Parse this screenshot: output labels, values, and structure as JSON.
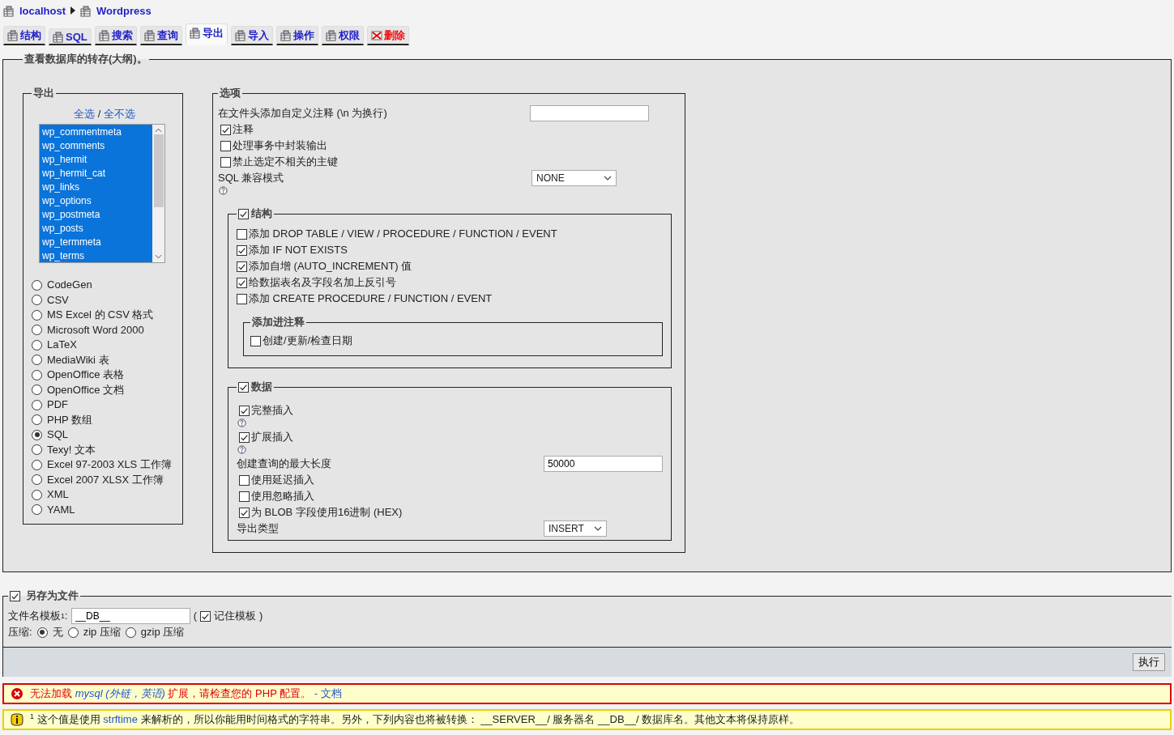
{
  "breadcrumb": [
    {
      "label": "localhost"
    },
    {
      "label": "Wordpress"
    }
  ],
  "tabs": [
    {
      "label": "结构",
      "selected": false,
      "kind": "normal"
    },
    {
      "label": "SQL",
      "selected": false,
      "kind": "normal"
    },
    {
      "label": "搜索",
      "selected": false,
      "kind": "normal"
    },
    {
      "label": "查询",
      "selected": false,
      "kind": "normal"
    },
    {
      "label": "导出",
      "selected": true,
      "kind": "normal"
    },
    {
      "label": "导入",
      "selected": false,
      "kind": "normal"
    },
    {
      "label": "操作",
      "selected": false,
      "kind": "normal"
    },
    {
      "label": "权限",
      "selected": false,
      "kind": "normal"
    },
    {
      "label": "删除",
      "selected": false,
      "kind": "danger"
    }
  ],
  "main": {
    "title": "查看数据库的转存(大纲)。",
    "export": {
      "legend": "导出",
      "select_all": "全选",
      "separator": "/",
      "select_none": "全不选",
      "tables": [
        {
          "name": "wp_commentmeta",
          "selected": true
        },
        {
          "name": "wp_comments",
          "selected": true
        },
        {
          "name": "wp_hermit",
          "selected": true
        },
        {
          "name": "wp_hermit_cat",
          "selected": true
        },
        {
          "name": "wp_links",
          "selected": true
        },
        {
          "name": "wp_options",
          "selected": true
        },
        {
          "name": "wp_postmeta",
          "selected": true
        },
        {
          "name": "wp_posts",
          "selected": true
        },
        {
          "name": "wp_termmeta",
          "selected": true
        },
        {
          "name": "wp_terms",
          "selected": true
        }
      ],
      "formats": [
        {
          "label": "CodeGen",
          "selected": false
        },
        {
          "label": "CSV",
          "selected": false
        },
        {
          "label": "MS Excel 的 CSV 格式",
          "selected": false
        },
        {
          "label": "Microsoft Word 2000",
          "selected": false
        },
        {
          "label": "LaTeX",
          "selected": false
        },
        {
          "label": "MediaWiki 表",
          "selected": false
        },
        {
          "label": "OpenOffice 表格",
          "selected": false
        },
        {
          "label": "OpenOffice 文档",
          "selected": false
        },
        {
          "label": "PDF",
          "selected": false
        },
        {
          "label": "PHP 数组",
          "selected": false
        },
        {
          "label": "SQL",
          "selected": true
        },
        {
          "label": "Texy! 文本",
          "selected": false
        },
        {
          "label": "Excel 97-2003 XLS 工作簿",
          "selected": false
        },
        {
          "label": "Excel 2007 XLSX 工作簿",
          "selected": false
        },
        {
          "label": "XML",
          "selected": false
        },
        {
          "label": "YAML",
          "selected": false
        }
      ]
    },
    "options": {
      "legend": "选项",
      "header_comment": {
        "label": "在文件头添加自定义注释 (\\n 为换行)"
      },
      "checkboxes": [
        {
          "label": "注释",
          "checked": true
        },
        {
          "label": "处理事务中封装输出",
          "checked": false
        },
        {
          "label": "禁止选定不相关的主键",
          "checked": false
        }
      ],
      "sql_compat": {
        "label": "SQL 兼容模式",
        "value": "NONE"
      },
      "structure": {
        "label": "结构",
        "checked": true,
        "options": [
          {
            "label": "添加 DROP TABLE / VIEW / PROCEDURE / FUNCTION / EVENT",
            "checked": false
          },
          {
            "label": "添加 IF NOT EXISTS",
            "checked": true
          },
          {
            "label": "添加自增 (AUTO_INCREMENT) 值",
            "checked": true
          },
          {
            "label": "给数据表名及字段名加上反引号",
            "checked": true
          },
          {
            "label": "添加 CREATE PROCEDURE / FUNCTION / EVENT",
            "checked": false
          }
        ],
        "comments": {
          "legend": "添加进注释",
          "options": [
            {
              "label": "创建/更新/检查日期",
              "checked": false
            }
          ]
        }
      },
      "data": {
        "label": "数据",
        "checked": true,
        "items": [
          {
            "kind": "checkbox",
            "label": "完整插入",
            "checked": true
          },
          {
            "kind": "help"
          },
          {
            "kind": "checkbox",
            "label": "扩展插入",
            "checked": true
          },
          {
            "kind": "help"
          },
          {
            "kind": "input",
            "label": "创建查询的最大长度",
            "value": "50000"
          },
          {
            "kind": "checkbox",
            "label": "使用延迟插入",
            "checked": false
          },
          {
            "kind": "checkbox",
            "label": "使用忽略插入",
            "checked": false
          },
          {
            "kind": "checkbox",
            "label": "为 BLOB 字段使用16进制 (HEX)",
            "checked": true
          },
          {
            "kind": "select",
            "label": "导出类型",
            "value": "INSERT"
          }
        ]
      }
    }
  },
  "save_file": {
    "label": "另存为文件",
    "checked": true,
    "filename_label": "文件名模板",
    "footnote": "1",
    "colon": ":",
    "value": "__DB__",
    "paren_open": "(",
    "paren_close": ")",
    "remember": {
      "label": "记住模板",
      "checked": true
    },
    "compression_label": "压缩:",
    "compression": [
      {
        "label": "无",
        "selected": true
      },
      {
        "label": "zip 压缩",
        "selected": false
      },
      {
        "label": "gzip 压缩",
        "selected": false
      }
    ]
  },
  "go_button": "执行",
  "error": {
    "text_before": "无法加载",
    "link": "mysql (外链，英语)",
    "text_after": "扩展，请检查您的 PHP 配置。",
    "separator": "-",
    "doc_link": "文档"
  },
  "notice": {
    "footnote": "1",
    "text_before": "这个值是使用",
    "link": "strftime",
    "text_after": "来解析的，所以你能用时间格式的字符串。另外，下列内容也将被转换： __SERVER__/ 服务器名 __DB__/ 数据库名。其他文本将保持原样。"
  }
}
